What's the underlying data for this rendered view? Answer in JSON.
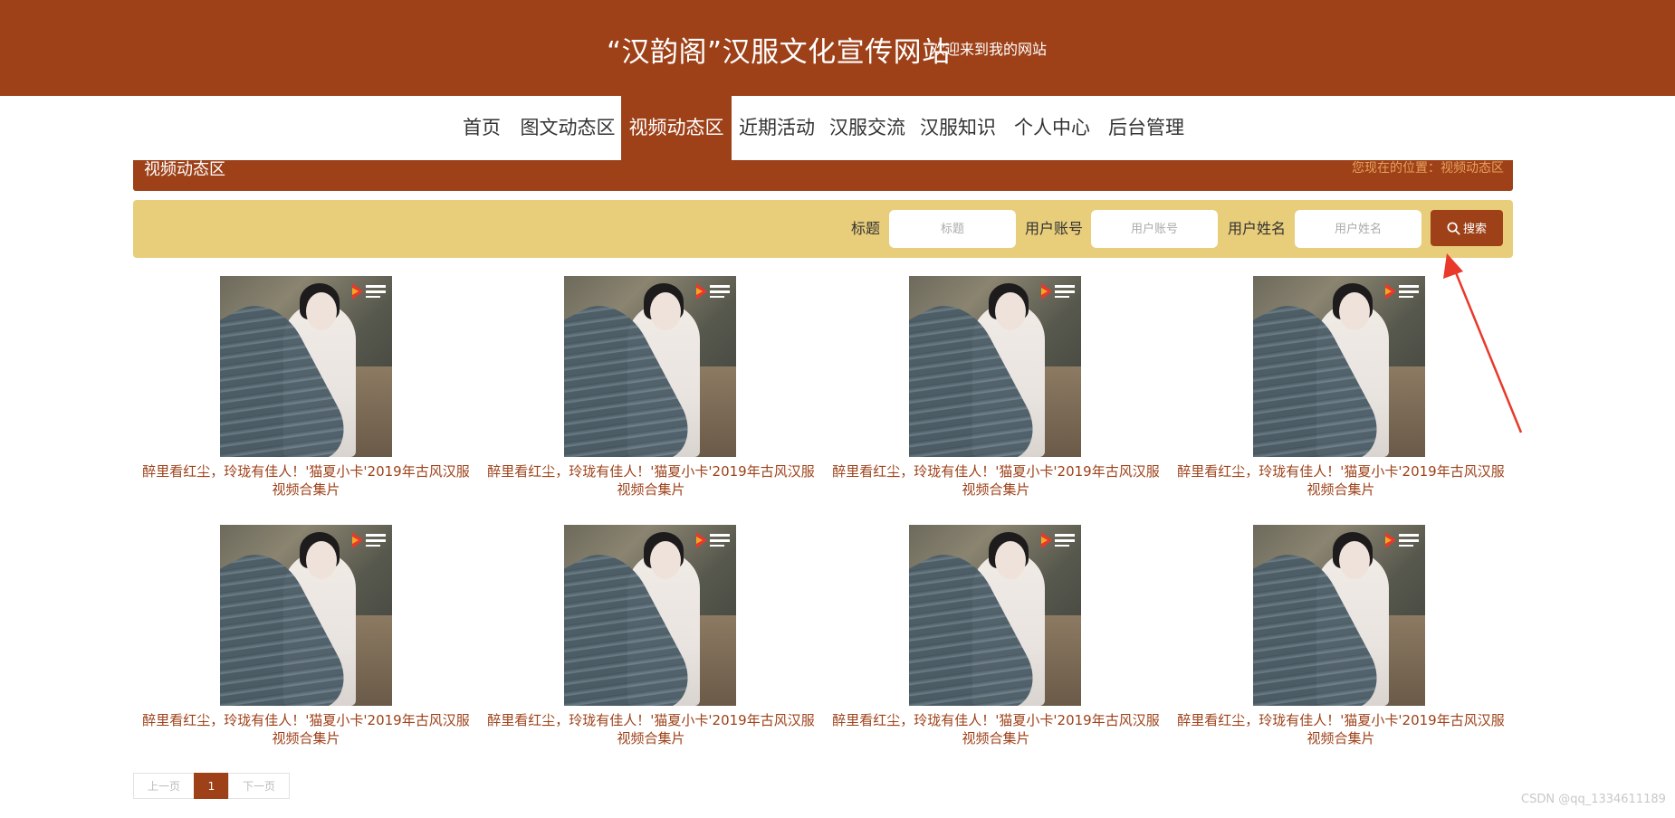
{
  "header": {
    "site_title": "“汉韵阁”汉服文化宣传网站",
    "welcome": "欢迎来到我的网站"
  },
  "nav": {
    "items": [
      {
        "label": "首页",
        "active": false
      },
      {
        "label": "图文动态区",
        "active": false
      },
      {
        "label": "视频动态区",
        "active": true
      },
      {
        "label": "近期活动",
        "active": false
      },
      {
        "label": "汉服交流",
        "active": false
      },
      {
        "label": "汉服知识",
        "active": false
      },
      {
        "label": "个人中心",
        "active": false
      },
      {
        "label": "后台管理",
        "active": false
      }
    ]
  },
  "section": {
    "title": "视频动态区",
    "breadcrumb": "您现在的位置：视频动态区"
  },
  "search": {
    "title_label": "标题",
    "title_placeholder": "标题",
    "account_label": "用户账号",
    "account_placeholder": "用户账号",
    "name_label": "用户姓名",
    "name_placeholder": "用户姓名",
    "button_label": "搜索"
  },
  "videos": [
    {
      "title": "醉里看红尘，玲珑有佳人！'猫夏小卡'2019年古风汉服视频合集片"
    },
    {
      "title": "醉里看红尘，玲珑有佳人！'猫夏小卡'2019年古风汉服视频合集片"
    },
    {
      "title": "醉里看红尘，玲珑有佳人！'猫夏小卡'2019年古风汉服视频合集片"
    },
    {
      "title": "醉里看红尘，玲珑有佳人！'猫夏小卡'2019年古风汉服视频合集片"
    },
    {
      "title": "醉里看红尘，玲珑有佳人！'猫夏小卡'2019年古风汉服视频合集片"
    },
    {
      "title": "醉里看红尘，玲珑有佳人！'猫夏小卡'2019年古风汉服视频合集片"
    },
    {
      "title": "醉里看红尘，玲珑有佳人！'猫夏小卡'2019年古风汉服视频合集片"
    },
    {
      "title": "醉里看红尘，玲珑有佳人！'猫夏小卡'2019年古风汉服视频合集片"
    }
  ],
  "pagination": {
    "prev": "上一页",
    "current": "1",
    "next": "下一页"
  },
  "watermark": "CSDN @qq_1334611189",
  "colors": {
    "brand": "#9e4119",
    "search_bar": "#e8cd7a",
    "breadcrumb": "#e8a15c",
    "annotation_arrow": "#e8392b"
  },
  "icons": {
    "search_button": "search-icon",
    "thumbnail_logo": "play-logo-icon",
    "annotation": "red-arrow-icon"
  }
}
